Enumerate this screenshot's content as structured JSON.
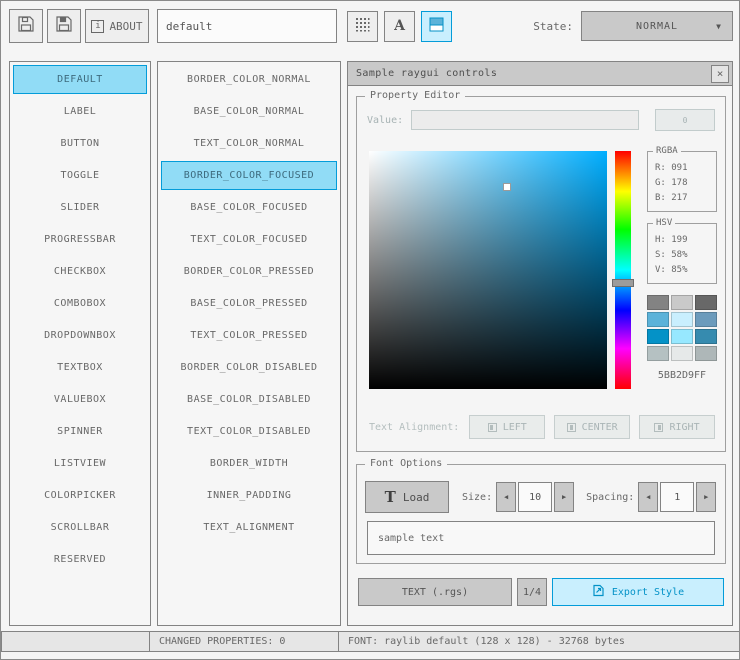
{
  "toolbar": {
    "about_label": "ABOUT",
    "style_name": "default",
    "state_label": "State:",
    "state_value": "NORMAL"
  },
  "icons": {
    "info": "i",
    "font_a": "A",
    "close": "×",
    "dropdown_arrow": "▼",
    "spinner_left": "◀",
    "spinner_right": "▶"
  },
  "controls": {
    "items": [
      "DEFAULT",
      "LABEL",
      "BUTTON",
      "TOGGLE",
      "SLIDER",
      "PROGRESSBAR",
      "CHECKBOX",
      "COMBOBOX",
      "DROPDOWNBOX",
      "TEXTBOX",
      "VALUEBOX",
      "SPINNER",
      "LISTVIEW",
      "COLORPICKER",
      "SCROLLBAR",
      "RESERVED"
    ],
    "selected": "DEFAULT"
  },
  "properties": {
    "items": [
      "BORDER_COLOR_NORMAL",
      "BASE_COLOR_NORMAL",
      "TEXT_COLOR_NORMAL",
      "BORDER_COLOR_FOCUSED",
      "BASE_COLOR_FOCUSED",
      "TEXT_COLOR_FOCUSED",
      "BORDER_COLOR_PRESSED",
      "BASE_COLOR_PRESSED",
      "TEXT_COLOR_PRESSED",
      "BORDER_COLOR_DISABLED",
      "BASE_COLOR_DISABLED",
      "TEXT_COLOR_DISABLED",
      "BORDER_WIDTH",
      "INNER_PADDING",
      "TEXT_ALIGNMENT"
    ],
    "selected": "BORDER_COLOR_FOCUSED"
  },
  "sample_window": {
    "title": "Sample raygui controls",
    "property_editor": {
      "legend": "Property Editor",
      "value_label": "Value:",
      "value_button_label": "0",
      "rgba": {
        "legend": "RGBA",
        "r": "R: 091",
        "g": "G: 178",
        "b": "B: 217"
      },
      "hsv": {
        "legend": "HSV",
        "h": "H: 199",
        "s": "S: 58%",
        "v": "V: 85%"
      },
      "hsv_numeric": {
        "h": 199,
        "s": 58,
        "v": 85
      },
      "hex_value": "5BB2D9FF",
      "alignment_label": "Text Alignment:",
      "alignment_options": [
        "LEFT",
        "CENTER",
        "RIGHT"
      ]
    },
    "font_options": {
      "legend": "Font Options",
      "load_icon": "T",
      "load_button": "Load",
      "size_label": "Size:",
      "size_value": "10",
      "spacing_label": "Spacing:",
      "spacing_value": "1",
      "sample_text": "sample text"
    },
    "export_bar": {
      "format_button": "TEXT (.rgs)",
      "page_button": "1/4",
      "export_button": "Export Style"
    }
  },
  "statusbar": {
    "changed_properties": "CHANGED PROPERTIES: 0",
    "font_info": "FONT: raylib default (128 x 128) - 32768 bytes"
  },
  "palette": [
    "#838383",
    "#c9c9c9",
    "#686868",
    "#5bb2d9",
    "#c9effe",
    "#6c9bbc",
    "#0492c7",
    "#97e8ff",
    "#368baf",
    "#b5c1c2",
    "#e6e9e9",
    "#aeb7b8"
  ],
  "colors": {
    "accent_border": "#0492c7",
    "accent_fill": "#97e8ff",
    "focus_fill": "#c9effe",
    "selected_color": "#5bb2d9"
  }
}
